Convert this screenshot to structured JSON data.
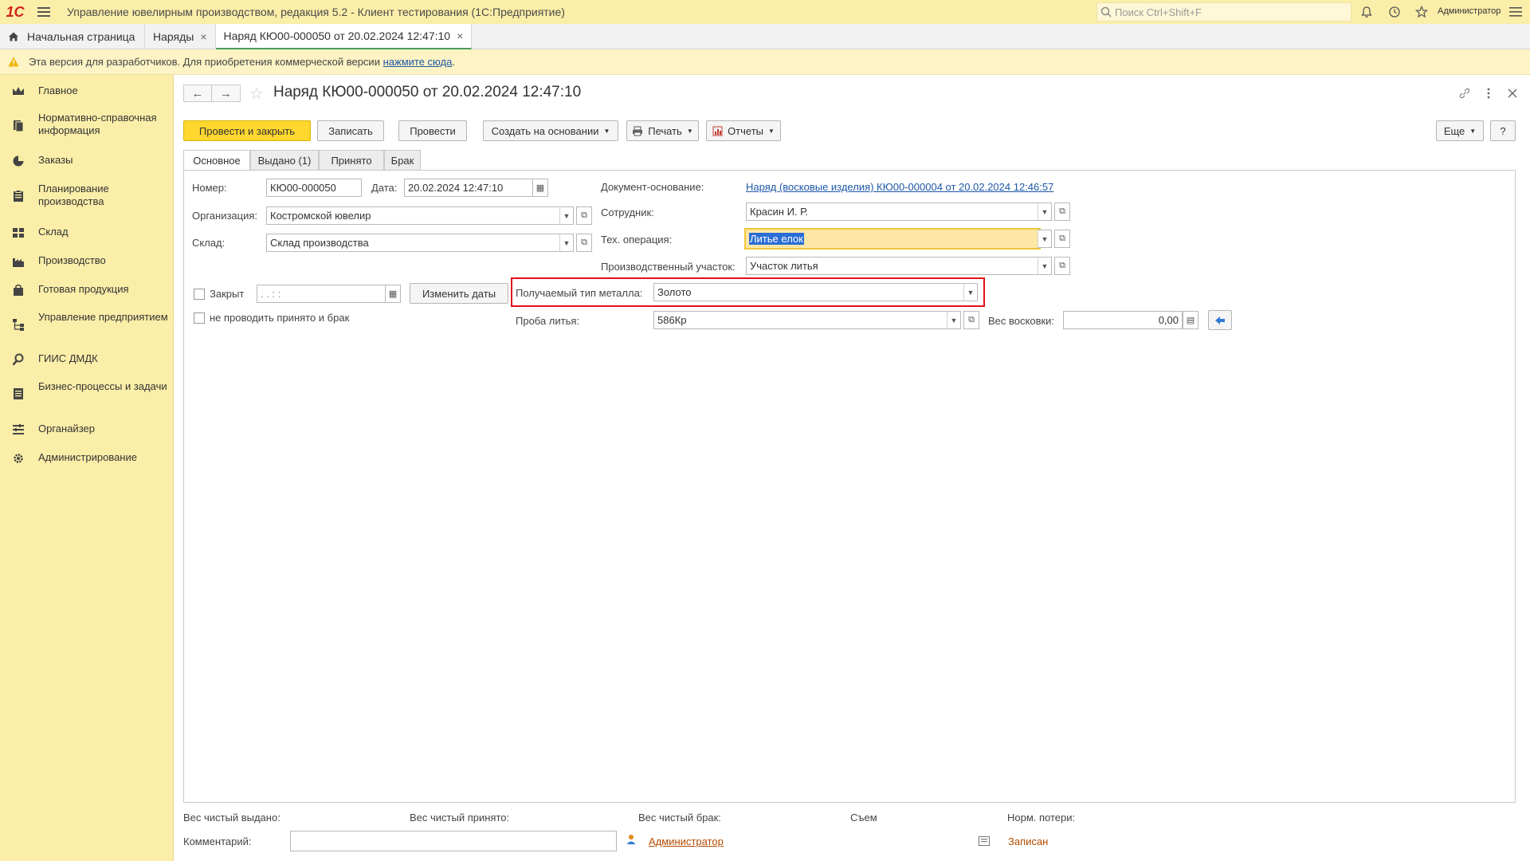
{
  "app": {
    "logo": "1С",
    "title": "Управление ювелирным производством, редакция 5.2  - Клиент тестирования (1С:Предприятие)",
    "search_placeholder": "Поиск Ctrl+Shift+F",
    "user": "Администратор"
  },
  "window_tabs": [
    {
      "label": "Начальная страница"
    },
    {
      "label": "Наряды"
    },
    {
      "label": "Наряд КЮ00-000050 от 20.02.2024 12:47:10"
    }
  ],
  "warning": {
    "text": "Эта версия для разработчиков. Для приобретения коммерческой версии",
    "link": "нажмите сюда",
    "suffix": "."
  },
  "sidebar": {
    "items": [
      {
        "label": "Главное",
        "icon": "crown-icon"
      },
      {
        "label": "Нормативно-справочная информация",
        "icon": "books-icon"
      },
      {
        "label": "Заказы",
        "icon": "pie-chart-icon"
      },
      {
        "label": "Планирование производства",
        "icon": "clipboard-icon"
      },
      {
        "label": "Склад",
        "icon": "grid-icon"
      },
      {
        "label": "Производство",
        "icon": "factory-icon"
      },
      {
        "label": "Готовая продукция",
        "icon": "bag-icon"
      },
      {
        "label": "Управление предприятием",
        "icon": "org-chart-icon"
      },
      {
        "label": "ГИИС ДМДК",
        "icon": "magnifier-icon"
      },
      {
        "label": "Бизнес-процессы и задачи",
        "icon": "document-list-icon"
      },
      {
        "label": "Органайзер",
        "icon": "organizer-icon"
      },
      {
        "label": "Администрирование",
        "icon": "gear-icon"
      }
    ]
  },
  "document": {
    "title": "Наряд КЮ00-000050 от 20.02.2024 12:47:10",
    "toolbar": {
      "post_close": "Провести и закрыть",
      "save": "Записать",
      "post": "Провести",
      "create_based": "Создать на основании",
      "print": "Печать",
      "reports": "Отчеты",
      "more": "Еще",
      "help": "?"
    },
    "tabs": [
      "Основное",
      "Выдано (1)",
      "Принято",
      "Брак"
    ],
    "form": {
      "number_label": "Номер:",
      "number": "КЮ00-000050",
      "date_label": "Дата:",
      "date": "20.02.2024 12:47:10",
      "org_label": "Организация:",
      "org": "Костромской ювелир",
      "warehouse_label": "Склад:",
      "warehouse": "Склад производства",
      "basis_label": "Документ-основание:",
      "basis": "Наряд (восковые изделия) КЮ00-000004 от 20.02.2024 12:46:57",
      "employee_label": "Сотрудник:",
      "employee": "Красин И. Р.",
      "operation_label": "Тех. операция:",
      "operation": "Литье елок",
      "section_label": "Производственный участок:",
      "section": "Участок литья",
      "closed_label": "Закрыт",
      "closed_date": " .  .       :  :",
      "change_dates": "Изменить даты",
      "no_post_label": "не проводить принято и брак",
      "metal_type_label": "Получаемый тип металла:",
      "metal_type": "Золото",
      "probe_label": "Проба литья:",
      "probe": "586Кр",
      "wax_weight_label": "Вес восковки:",
      "wax_weight": "0,00"
    },
    "footer": {
      "net_issued": "Вес чистый выдано:",
      "net_received": "Вес чистый принято:",
      "net_defect": "Вес чистый брак:",
      "removal": "Съем",
      "norm_loss": "Норм. потери:",
      "comment_label": "Комментарий:",
      "comment": "",
      "author": "Администратор",
      "status": "Записан"
    }
  },
  "colors": {
    "sidebar_bg": "#fbeea8",
    "primary_button": "#ffd72e",
    "highlight_border": "#e2101a",
    "link": "#1d58a8"
  }
}
